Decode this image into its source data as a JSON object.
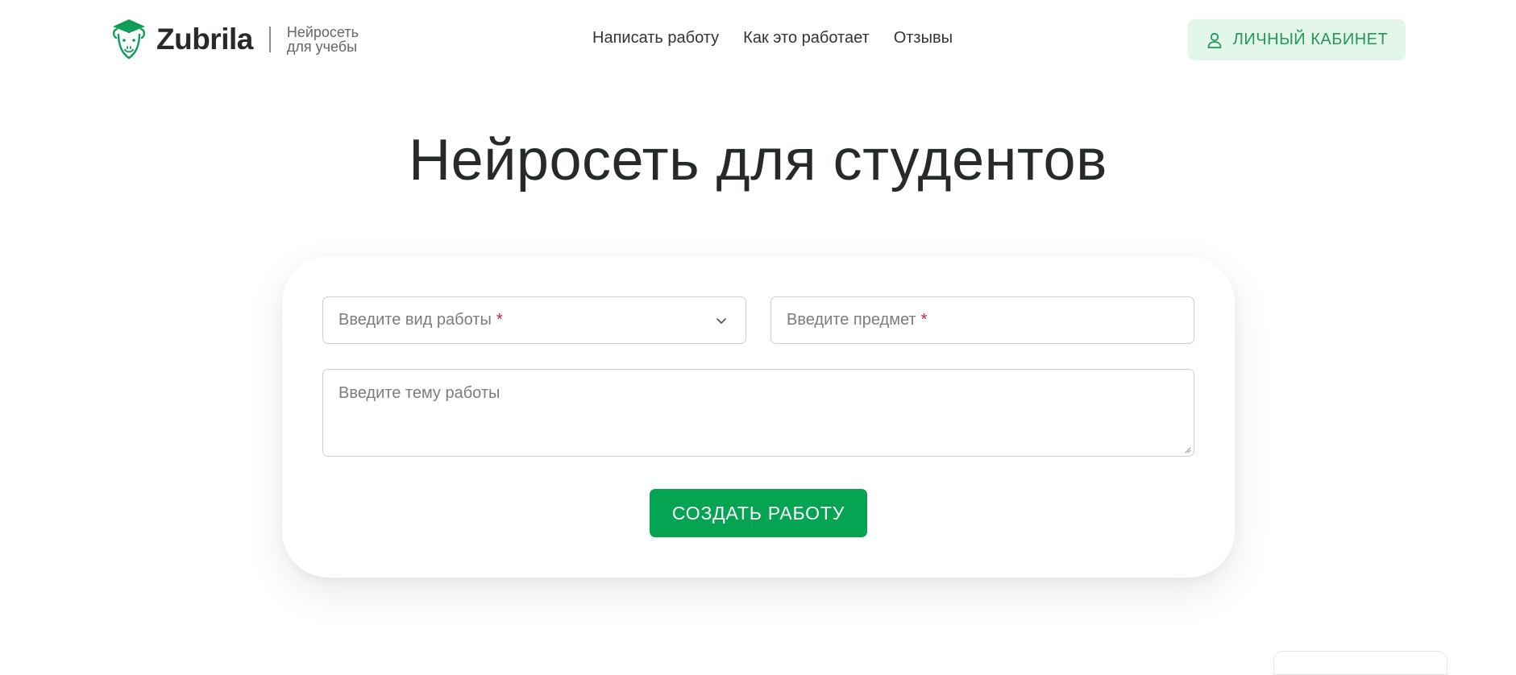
{
  "header": {
    "logo_text": "Zubrila",
    "tagline_line1": "Нейросеть",
    "tagline_line2": "для учебы",
    "nav": [
      {
        "label": "Написать работу"
      },
      {
        "label": "Как это работает"
      },
      {
        "label": "Отзывы"
      }
    ],
    "cabinet_label": "ЛИЧНЫЙ КАБИНЕТ"
  },
  "hero": {
    "title": "Нейросеть для студентов"
  },
  "form": {
    "work_type_placeholder": "Введите вид работы",
    "subject_placeholder": "Введите предмет",
    "required_mark": "*",
    "topic_placeholder": "Введите тему работы",
    "submit_label": "СОЗДАТЬ РАБОТУ"
  },
  "colors": {
    "brand_green": "#04a452",
    "cabinet_bg": "#e2f6ea",
    "required": "#e0202a"
  },
  "icons": {
    "logo": "bison-graduation-cap-icon",
    "cabinet": "user-icon",
    "dropdown": "chevron-down-icon"
  }
}
